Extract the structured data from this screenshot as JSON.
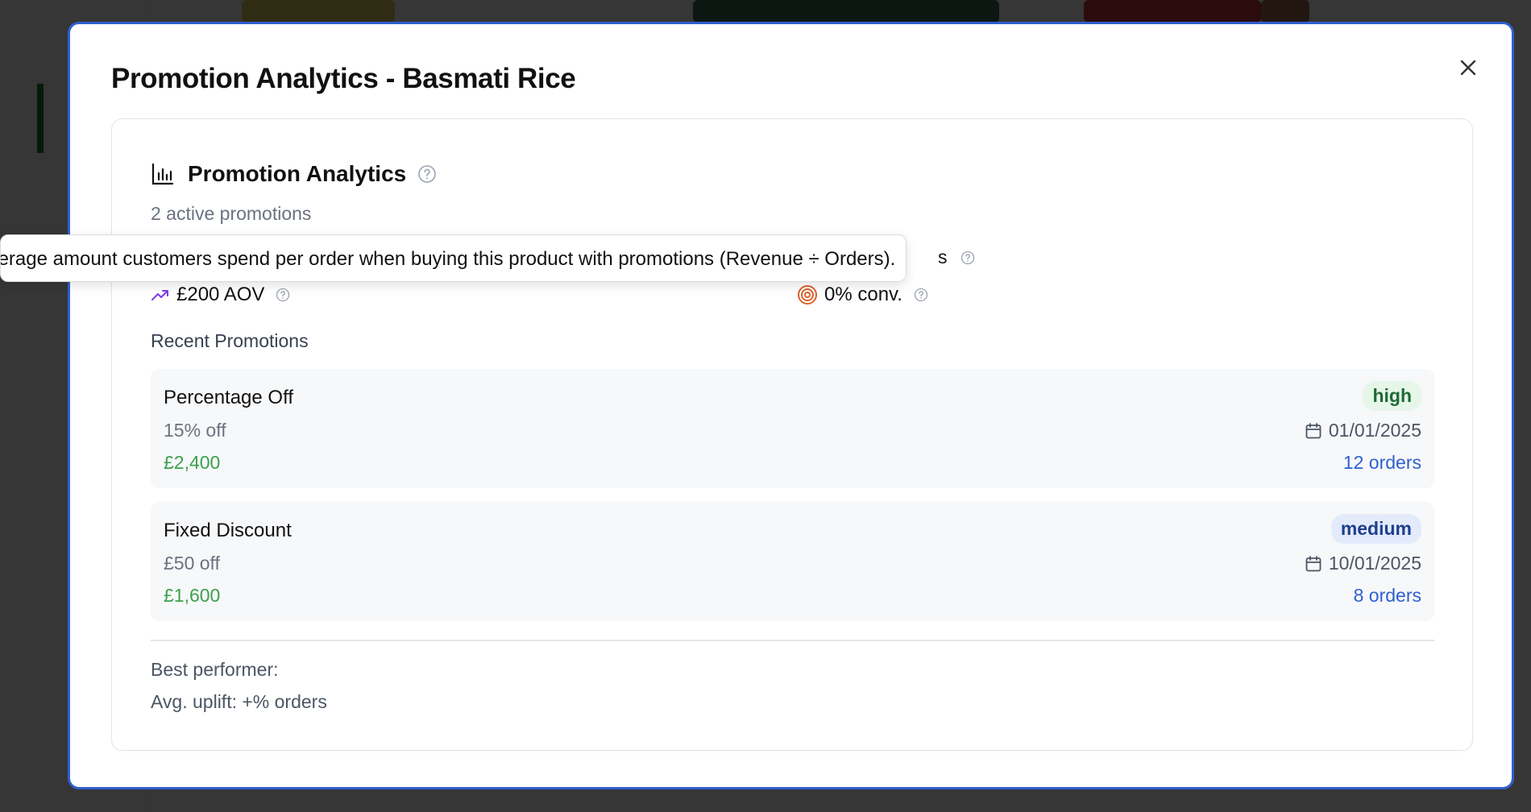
{
  "modal": {
    "title": "Promotion Analytics - Basmati Rice"
  },
  "card": {
    "title": "Promotion Analytics",
    "subtitle": "2 active promotions"
  },
  "metrics": {
    "aov_label": "£200 AOV",
    "conversion_label": "0% conv.",
    "hidden_metric_tail": "s"
  },
  "tooltip": {
    "text": "Average amount customers spend per order when buying this product with promotions (Revenue ÷ Orders)."
  },
  "recent": {
    "label": "Recent Promotions",
    "items": [
      {
        "name": "Percentage Off",
        "description": "15% off",
        "revenue": "£2,400",
        "badge": "high",
        "date": "01/01/2025",
        "orders": "12 orders"
      },
      {
        "name": "Fixed Discount",
        "description": "£50 off",
        "revenue": "£1,600",
        "badge": "medium",
        "date": "10/01/2025",
        "orders": "8 orders"
      }
    ]
  },
  "summary": {
    "best_performer": "Best performer:",
    "avg_uplift": "Avg. uplift: +% orders"
  },
  "colors": {
    "accent": "#2f5fd0",
    "revenue_green": "#3ca04c",
    "badge_high_bg": "#e6f6e9",
    "badge_medium_bg": "#e3ebfb",
    "aov_icon": "#7c3aed",
    "conv_icon": "#d9622b"
  },
  "icons": {
    "close": "close-icon",
    "chart": "bar-chart-icon",
    "help": "help-circle-icon",
    "trend": "trending-up-icon",
    "target": "target-icon",
    "calendar": "calendar-icon"
  }
}
